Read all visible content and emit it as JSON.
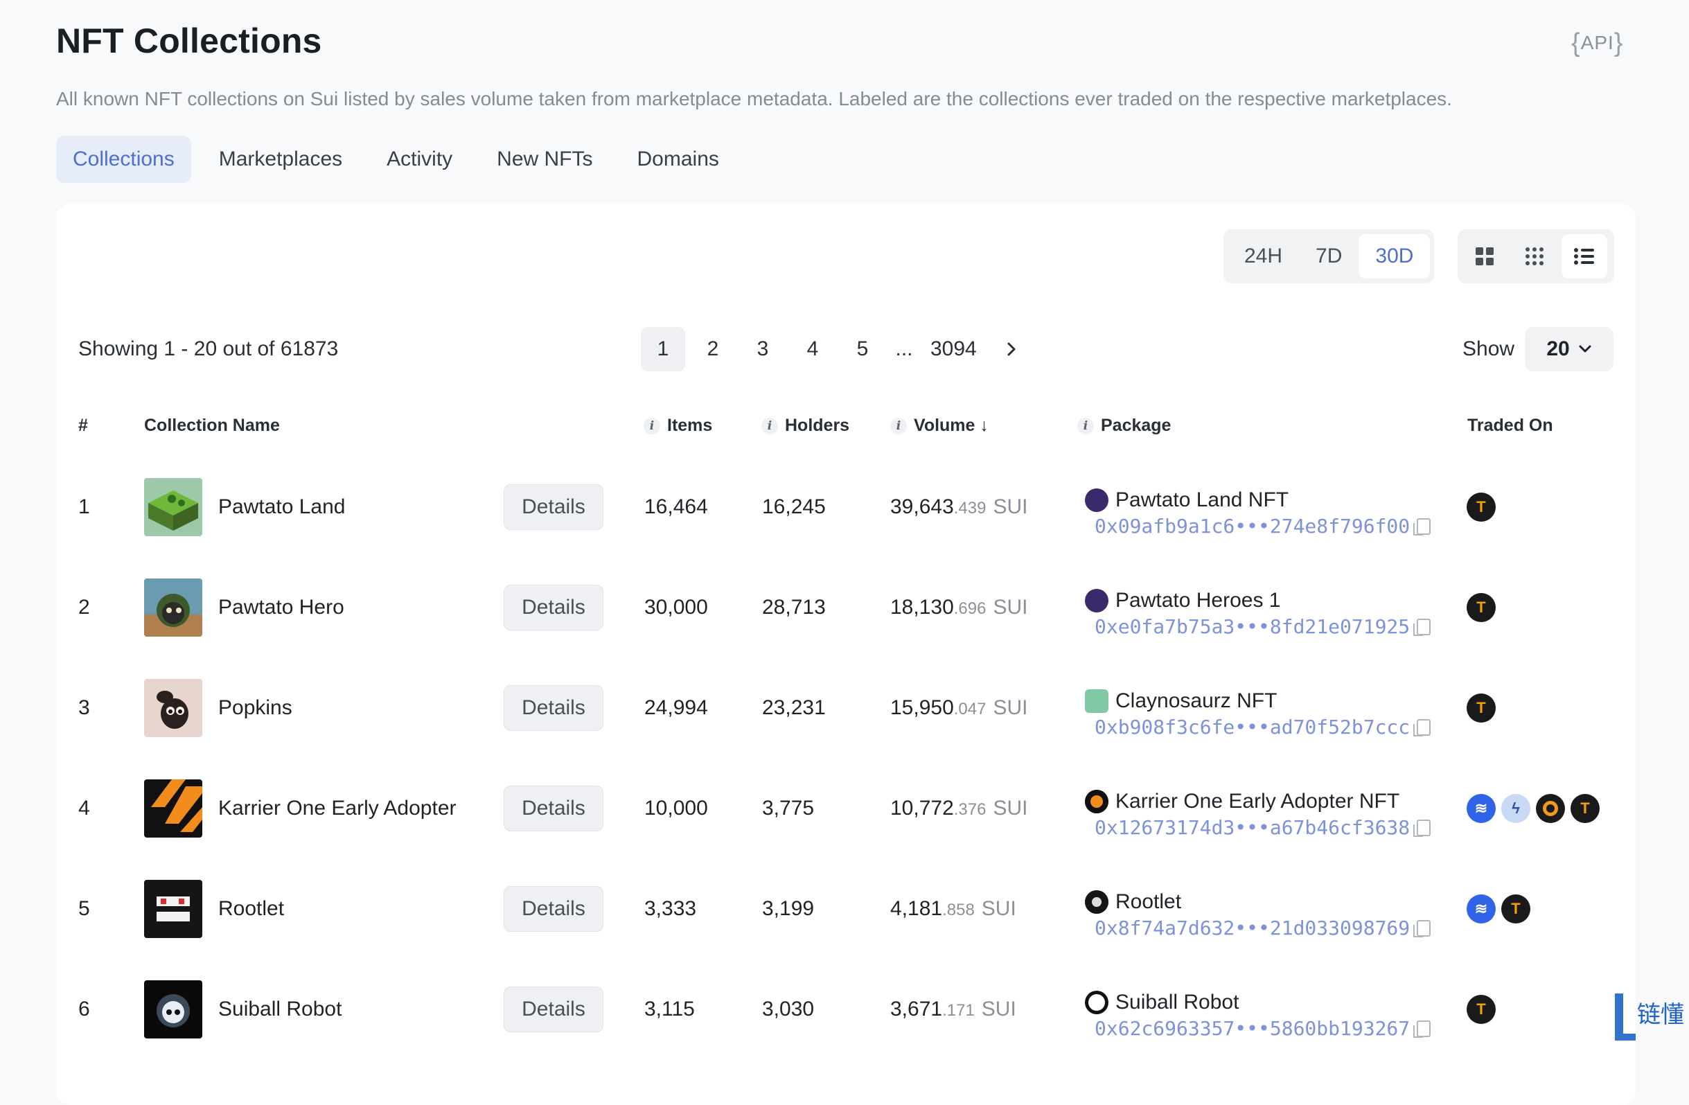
{
  "header": {
    "title": "NFT Collections",
    "api_label": "API",
    "description": "All known NFT collections on Sui listed by sales volume taken from marketplace metadata. Labeled are the collections ever traded on the respective marketplaces."
  },
  "tabs": [
    {
      "label": "Collections",
      "active": true
    },
    {
      "label": "Marketplaces"
    },
    {
      "label": "Activity"
    },
    {
      "label": "New NFTs"
    },
    {
      "label": "Domains"
    }
  ],
  "period": {
    "options": [
      "24H",
      "7D",
      "30D"
    ],
    "selected": "30D"
  },
  "view_modes": [
    {
      "icon": "grid-large-icon"
    },
    {
      "icon": "grid-small-icon"
    },
    {
      "icon": "list-icon",
      "active": true
    }
  ],
  "pagination": {
    "showing_text": "Showing 1 - 20 out of 61873",
    "pages": [
      "1",
      "2",
      "3",
      "4",
      "5"
    ],
    "ellipsis": "...",
    "last_page": "3094",
    "current": "1",
    "next_icon": "chevron-right-icon"
  },
  "page_size": {
    "label": "Show",
    "value": "20"
  },
  "columns": {
    "rank": "#",
    "name": "Collection Name",
    "items": "Items",
    "holders": "Holders",
    "volume": "Volume ↓",
    "package": "Package",
    "traded_on": "Traded On"
  },
  "details_label": "Details",
  "rows": [
    {
      "rank": "1",
      "name": "Pawtato Land",
      "items": "16,464",
      "holders": "16,245",
      "volume_int": "39,643",
      "volume_dec": ".439",
      "unit": "SUI",
      "package_name": "Pawtato Land NFT",
      "package_addr": "0x09afb9a1c6•••274e8f796f00",
      "markets": [
        "tradeport"
      ]
    },
    {
      "rank": "2",
      "name": "Pawtato Hero",
      "items": "30,000",
      "holders": "28,713",
      "volume_int": "18,130",
      "volume_dec": ".696",
      "unit": "SUI",
      "package_name": "Pawtato Heroes 1",
      "package_addr": "0xe0fa7b75a3•••8fd21e071925",
      "markets": [
        "tradeport"
      ]
    },
    {
      "rank": "3",
      "name": "Popkins",
      "items": "24,994",
      "holders": "23,231",
      "volume_int": "15,950",
      "volume_dec": ".047",
      "unit": "SUI",
      "package_name": "Claynosaurz NFT",
      "package_addr": "0xb908f3c6fe•••ad70f52b7ccc",
      "markets": [
        "tradeport"
      ]
    },
    {
      "rank": "4",
      "name": "Karrier One Early Adopter",
      "items": "10,000",
      "holders": "3,775",
      "volume_int": "10,772",
      "volume_dec": ".376",
      "unit": "SUI",
      "package_name": "Karrier One Early Adopter NFT",
      "package_addr": "0x12673174d3•••a67b46cf3638",
      "markets": [
        "wave",
        "bolt",
        "ring",
        "tradeport"
      ]
    },
    {
      "rank": "5",
      "name": "Rootlet",
      "items": "3,333",
      "holders": "3,199",
      "volume_int": "4,181",
      "volume_dec": ".858",
      "unit": "SUI",
      "package_name": "Rootlet",
      "package_addr": "0x8f74a7d632•••21d033098769",
      "markets": [
        "wave",
        "tradeport"
      ]
    },
    {
      "rank": "6",
      "name": "Suiball Robot",
      "items": "3,115",
      "holders": "3,030",
      "volume_int": "3,671",
      "volume_dec": ".171",
      "unit": "SUI",
      "package_name": "Suiball Robot",
      "package_addr": "0x62c6963357•••5860bb193267",
      "markets": [
        "tradeport"
      ]
    }
  ],
  "watermark": "链懂"
}
